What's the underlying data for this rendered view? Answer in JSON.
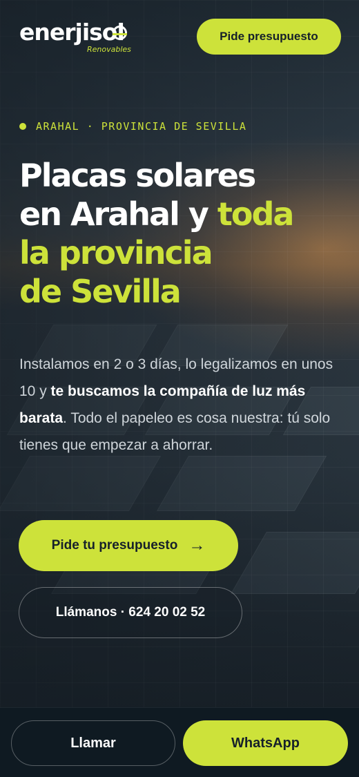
{
  "brand": {
    "logo_text": "enerjisol",
    "logo_subtitle": "Renovables",
    "accent_color": "#cde23a",
    "background_color": "#151d24"
  },
  "header": {
    "quote_button_label": "Pide presupuesto"
  },
  "hero": {
    "location": "ARAHAL · PROVINCIA DE SEVILLA",
    "headline": {
      "line1": "Placas solares",
      "line2_white": "en Arahal y ",
      "line2_accent": "toda",
      "line3_accent": "la provincia",
      "line4_accent": "de Sevilla"
    },
    "description": {
      "part1": "Instalamos en 2 o 3 días, lo legalizamos en unos 10 y ",
      "bold": "te buscamos la compañía de luz más barata",
      "part2": ". Todo el papeleo es cosa nuestra: tú solo tienes que empezar a ahorrar."
    },
    "primary_button_label": "Pide tu presupuesto",
    "primary_button_arrow": "→",
    "call_button_label": "Llámanos · 624 20 02 52"
  },
  "bottom_bar": {
    "call_label": "Llamar",
    "whatsapp_label": "WhatsApp"
  },
  "icons": {
    "arrow": "arrow-right-icon",
    "location_dot": "location-dot-icon",
    "logo_sun": "sun-icon"
  }
}
